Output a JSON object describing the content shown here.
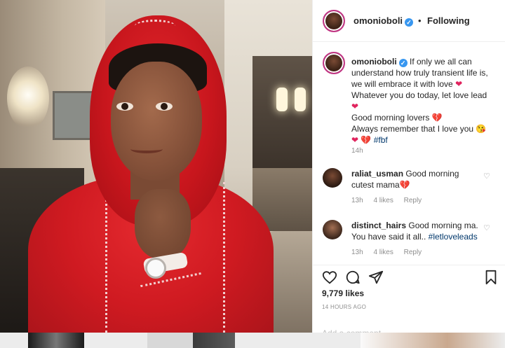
{
  "header": {
    "username": "omonioboli",
    "verified_glyph": "✓",
    "dot": "•",
    "follow_status": "Following"
  },
  "caption": {
    "username": "omonioboli",
    "line1": "If only we all can understand how truly transient life is, we will embrace it with love",
    "line2": "Whatever you do today, let love lead",
    "line3": "Good morning lovers",
    "line4": "Always remember that I love you",
    "hashtag": "#fbf",
    "time": "14h",
    "emoji": {
      "heart": "❤",
      "broken_heart": "💔",
      "kiss_face": "😘"
    }
  },
  "comments": [
    {
      "username": "raliat_usman",
      "text": "Good morning cutest mama",
      "time": "13h",
      "likes": "4 likes",
      "reply": "Reply"
    },
    {
      "username": "distinct_hairs",
      "text": "Good morning ma. You have said it all..",
      "hashtag": "#letloveleads",
      "time": "13h",
      "likes": "4 likes",
      "reply": "Reply"
    }
  ],
  "actions": {
    "icons": [
      "heart-icon",
      "comment-icon",
      "share-icon",
      "bookmark-icon"
    ],
    "likes": "9,779 likes",
    "posted": "14 HOURS AGO",
    "add_comment_placeholder": "Add a comment..."
  },
  "colors": {
    "verified": "#3897f0",
    "hashtag": "#00376b",
    "heart": "#e0245e",
    "meta": "#8e8e8e"
  }
}
